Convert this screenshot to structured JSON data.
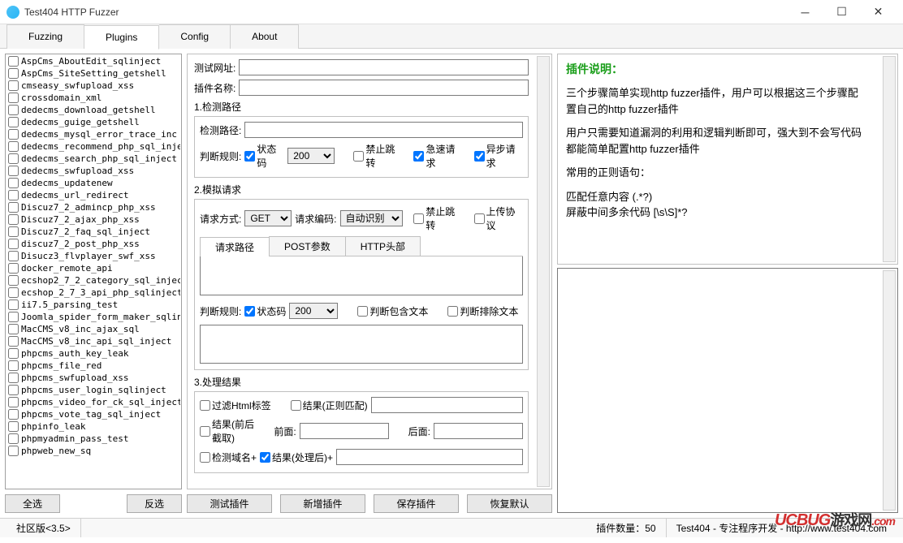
{
  "window": {
    "title": "Test404 HTTP Fuzzer"
  },
  "tabs": {
    "fuzzing": "Fuzzing",
    "plugins": "Plugins",
    "config": "Config",
    "about": "About"
  },
  "plugins": [
    "AspCms_AboutEdit_sqlinject",
    "AspCms_SiteSetting_getshell",
    "cmseasy_swfupload_xss",
    "crossdomain_xml",
    "dedecms_download_getshell",
    "dedecms_guige_getshell",
    "dedecms_mysql_error_trace_inc",
    "dedecms_recommend_php_sql_inje",
    "dedecms_search_php_sql_inject",
    "dedecms_swfupload_xss",
    "dedecms_updatenew",
    "dedecms_url_redirect",
    "Discuz7_2_admincp_php_xss",
    "Discuz7_2_ajax_php_xss",
    "Discuz7_2_faq_sql_inject",
    "discuz7_2_post_php_xss",
    "Disucz3_flvplayer_swf_xss",
    "docker_remote_api",
    "ecshop2_7_2_category_sql_injec",
    "ecshop_2_7_3_api_php_sqlinject",
    "ii7.5_parsing_test",
    "Joomla_spider_form_maker_sqlin",
    "MacCMS_v8_inc_ajax_sql",
    "MacCMS_v8_inc_api_sql_inject",
    "phpcms_auth_key_leak",
    "phpcms_file_red",
    "phpcms_swfupload_xss",
    "phpcms_user_login_sqlinject",
    "phpcms_video_for_ck_sql_inject",
    "phpcms_vote_tag_sql_inject",
    "phpinfo_leak",
    "phpmyadmin_pass_test",
    "phpweb_new_sq"
  ],
  "left_buttons": {
    "select_all": "全选",
    "invert": "反选"
  },
  "config": {
    "test_url_label": "测试网址:",
    "plugin_name_label": "插件名称:",
    "section1": "1.检测路径",
    "detect_path_label": "检测路径:",
    "judge_rule_label": "判断规则:",
    "status_code_label": "状态码",
    "status_code_value": "200",
    "no_redirect": "禁止跳转",
    "fast_req": "急速请求",
    "async_req": "异步请求",
    "section2": "2.模拟请求",
    "req_method_label": "请求方式:",
    "req_method_value": "GET",
    "req_encoding_label": "请求编码:",
    "req_encoding_value": "自动识别",
    "upload_proto": "上传协议",
    "sub_tabs": {
      "req_path": "请求路径",
      "post_params": "POST参数",
      "http_header": "HTTP头部"
    },
    "judge_contains": "判断包含文本",
    "judge_exclude": "判断排除文本",
    "section3": "3.处理结果",
    "filter_html": "过滤Html标签",
    "result_regex": "结果(正则匹配)",
    "result_cut": "结果(前后截取)",
    "front_label": "前面:",
    "back_label": "后面:",
    "detect_domain": "检测域名+",
    "result_after": "结果(处理后)+"
  },
  "mid_buttons": {
    "test": "测试插件",
    "new": "新增插件",
    "save": "保存插件",
    "restore": "恢复默认"
  },
  "desc": {
    "title": "插件说明：",
    "p1": "三个步骤简单实现http fuzzer插件，用户可以根据这三个步骤配置自己的http fuzzer插件",
    "p2": "用户只需要知道漏洞的利用和逻辑判断即可，强大到不会写代码都能简单配置http fuzzer插件",
    "p3": "常用的正则语句：",
    "p4": "匹配任意内容 (.*?)\n屏蔽中间多余代码 [\\s\\S]*?"
  },
  "statusbar": {
    "version": "社区版<3.5>",
    "plugin_count_label": "插件数量：50",
    "credit": "Test404 - 专注程序开发 - http://www.test404.com"
  },
  "watermark": {
    "brand": "UCBUG",
    "cn": "游戏网",
    "dot": ".com"
  }
}
